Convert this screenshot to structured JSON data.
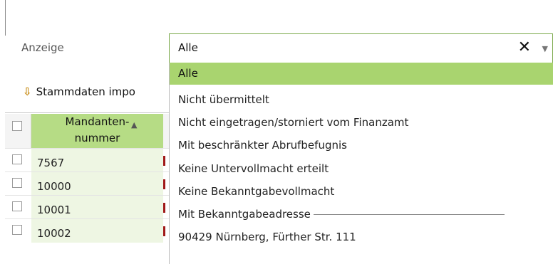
{
  "filter": {
    "label": "Anzeige",
    "value": "Alle",
    "clear_glyph": "✕",
    "arrow_glyph": "▼"
  },
  "toolbar": {
    "import_label": "Stammdaten impo",
    "import_icon": "arrow-down-icon"
  },
  "grid": {
    "header": {
      "mandanten_line1": "Mandanten-",
      "mandanten_line2": "nummer",
      "sort_glyph": "▲"
    },
    "rows": [
      {
        "nummer": "7567"
      },
      {
        "nummer": "10000"
      },
      {
        "nummer": "10001"
      },
      {
        "nummer": "10002"
      }
    ]
  },
  "dropdown": {
    "options": [
      "Alle",
      "Nicht übermittelt",
      "Nicht eingetragen/storniert vom Finanzamt",
      "Mit beschränkter Abrufbefugnis",
      "Keine Untervollmacht erteilt",
      "Keine Bekanntgabevollmacht"
    ],
    "selected_index": 0,
    "group_label": "Mit Bekanntgabeadresse",
    "group_items": [
      "90429 Nürnberg, Fürther Str. 111"
    ]
  },
  "colors": {
    "selected_bg": "#a9d46f",
    "header_bg": "#b6dc85",
    "row_bg": "#eef6e3",
    "combo_border": "#7aa84a"
  }
}
